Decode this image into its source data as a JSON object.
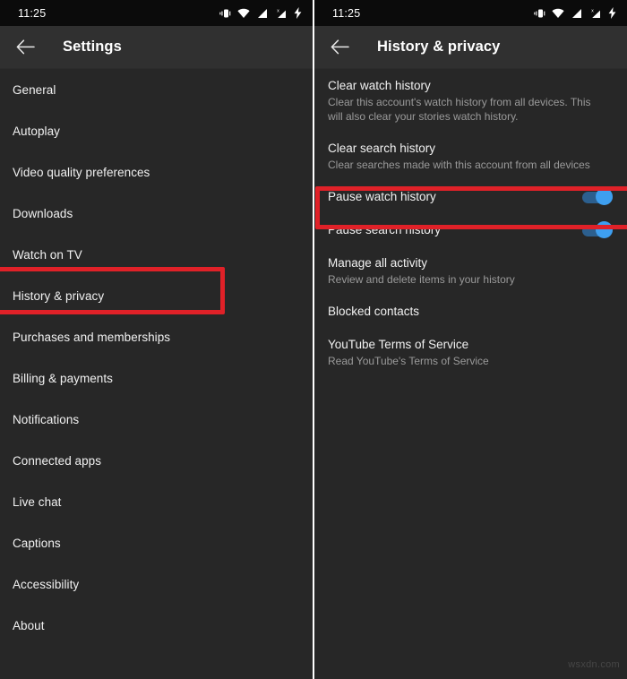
{
  "statusbar": {
    "time": "11:25",
    "icons": [
      "vibrate-icon",
      "wifi-icon",
      "signal-icon",
      "signal-no-sim-icon",
      "battery-charging-icon"
    ]
  },
  "left_screen": {
    "appbar": {
      "back_label": "back-arrow",
      "title": "Settings"
    },
    "items": [
      {
        "label": "General"
      },
      {
        "label": "Autoplay"
      },
      {
        "label": "Video quality preferences"
      },
      {
        "label": "Downloads"
      },
      {
        "label": "Watch on TV"
      },
      {
        "label": "History & privacy",
        "highlighted": true
      },
      {
        "label": "Purchases and memberships"
      },
      {
        "label": "Billing & payments"
      },
      {
        "label": "Notifications"
      },
      {
        "label": "Connected apps"
      },
      {
        "label": "Live chat"
      },
      {
        "label": "Captions"
      },
      {
        "label": "Accessibility"
      },
      {
        "label": "About"
      }
    ]
  },
  "right_screen": {
    "appbar": {
      "back_label": "back-arrow",
      "title": "History & privacy"
    },
    "items": [
      {
        "title": "Clear watch history",
        "subtitle": "Clear this account's watch history from all devices. This will also clear your stories watch history.",
        "toggle": null
      },
      {
        "title": "Clear search history",
        "subtitle": "Clear searches made with this account from all devices",
        "toggle": null
      },
      {
        "title": "Pause watch history",
        "subtitle": "",
        "toggle": "on",
        "highlighted": true
      },
      {
        "title": "Pause search history",
        "subtitle": "",
        "toggle": "on"
      },
      {
        "title": "Manage all activity",
        "subtitle": "Review and delete items in your history",
        "toggle": null
      },
      {
        "title": "Blocked contacts",
        "subtitle": "",
        "toggle": null
      },
      {
        "title": "YouTube Terms of Service",
        "subtitle": "Read YouTube's Terms of Service",
        "toggle": null
      }
    ]
  },
  "watermark": "wsxdn.com",
  "colors": {
    "background": "#272727",
    "appbar": "#303030",
    "statusbar": "#0b0b0b",
    "annotation_red": "#e02128",
    "toggle_thumb": "#3e9ff0",
    "toggle_track": "#2c5f8e",
    "primary_text": "#f1f1f1",
    "secondary_text": "#9a9a9a"
  }
}
